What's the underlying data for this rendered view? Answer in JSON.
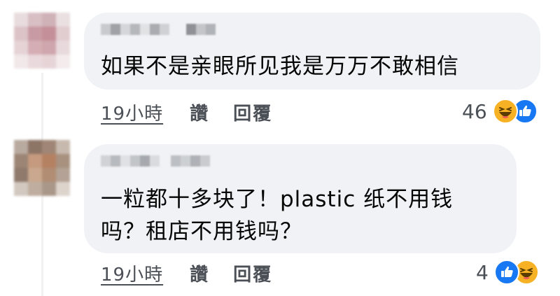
{
  "comments": [
    {
      "text_lines": [
        "如果不是亲眼所见我是万万不敢相信"
      ],
      "time": "19小時",
      "like_label": "讚",
      "reply_label": "回覆",
      "reaction_count": "46",
      "reactions": [
        "haha-icon",
        "like-icon"
      ]
    },
    {
      "text_lines": [
        "一粒都十多块了！plastic 纸不用钱",
        "吗？租店不用钱吗？"
      ],
      "time": "19小時",
      "like_label": "讚",
      "reply_label": "回覆",
      "reaction_count": "4",
      "reactions": [
        "like-icon",
        "haha-icon"
      ]
    }
  ],
  "colors": {
    "bubble": "#f0f2f5",
    "like_blue": "#1877f2",
    "haha_yellow": "#f7b125",
    "meta_text": "#4b4f56"
  }
}
